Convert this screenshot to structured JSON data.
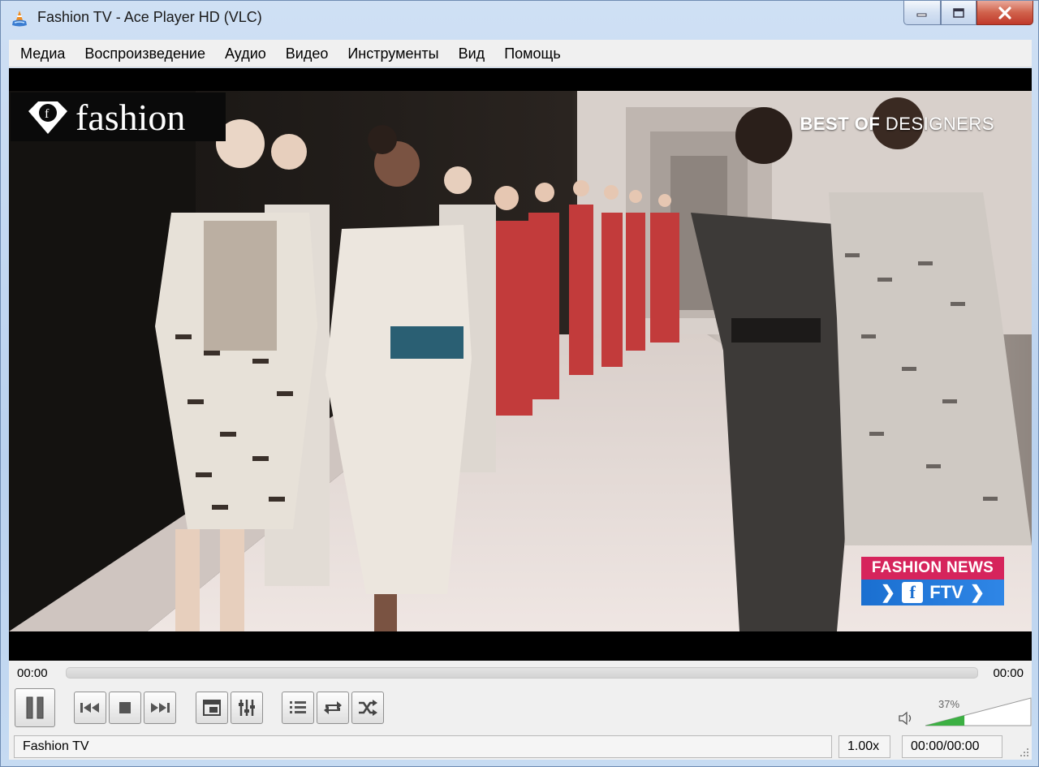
{
  "window": {
    "title": "Fashion TV - Ace Player HD (VLC)"
  },
  "menu": {
    "items": [
      {
        "label": "Медиа"
      },
      {
        "label": "Воспроизведение"
      },
      {
        "label": "Аудио"
      },
      {
        "label": "Видео"
      },
      {
        "label": "Инструменты"
      },
      {
        "label": "Вид"
      },
      {
        "label": "Помощь"
      }
    ]
  },
  "video": {
    "channel_logo": "fashion",
    "overlay_bold": "BEST OF",
    "overlay_rest": " DESIGNERS",
    "badge_top": "FASHION NEWS",
    "badge_bottom": "FTV",
    "badge_f": "f"
  },
  "controls": {
    "time_elapsed": "00:00",
    "time_total": "00:00",
    "seek_progress": 0,
    "volume_percent_label": "37%",
    "volume_fraction": 0.37,
    "buttons": [
      "pause-icon",
      "previous-icon",
      "stop-icon",
      "next-icon",
      "fullscreen-icon",
      "equalizer-icon",
      "playlist-icon",
      "loop-icon",
      "shuffle-icon"
    ]
  },
  "status": {
    "media_name": "Fashion TV",
    "speed": "1.00x",
    "time": "00:00/00:00"
  },
  "colors": {
    "accent": "#d6245c",
    "badge_blue": "#1a6fd0",
    "volume_green": "#3cb043"
  }
}
